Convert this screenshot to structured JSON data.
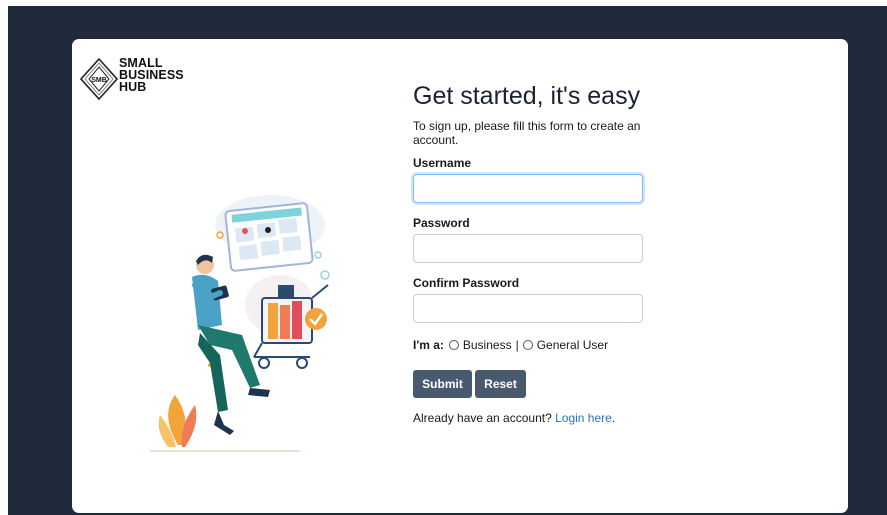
{
  "logo": {
    "badge": "SMB",
    "line1": "SMALL",
    "line2": "BUSINESS",
    "line3": "HUB"
  },
  "form": {
    "title": "Get started, it's easy",
    "subtitle": "To sign up, please fill this form to create an account.",
    "username_label": "Username",
    "username_value": "",
    "password_label": "Password",
    "password_value": "",
    "confirm_label": "Confirm Password",
    "confirm_value": "",
    "role_label": "I'm a:",
    "role_option_business": "Business",
    "role_separator": "|",
    "role_option_general": "General User",
    "submit_label": "Submit",
    "reset_label": "Reset",
    "login_prompt": "Already have an account?",
    "login_link": "Login here",
    "login_period": "."
  },
  "colors": {
    "background": "#1f2a3c",
    "button": "#4a5a6e",
    "link": "#2a74b8",
    "focus": "#86b7fe"
  },
  "icons": [
    "smb-diamond-logo-icon",
    "shopping-illustration"
  ]
}
